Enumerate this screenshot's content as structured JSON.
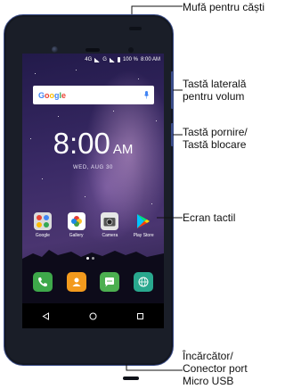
{
  "labels": {
    "headphone_jack": "Mufă pentru căști",
    "volume_key_1": "Tastă laterală",
    "volume_key_2": "pentru volum",
    "power_key_1": "Tastă pornire/",
    "power_key_2": "Tastă blocare",
    "touchscreen": "Ecran tactil",
    "charger_1": "Încărcător/",
    "charger_2": "Conector port",
    "charger_3": "Micro USB"
  },
  "screen": {
    "status": {
      "network": "4G",
      "network2": "G",
      "battery": "100 %",
      "time": "8:00 AM"
    },
    "search": {
      "logo": "Google",
      "icon": "mic-icon"
    },
    "clock": {
      "time": "8:00",
      "ampm": "AM",
      "date": "WED, AUG 30"
    },
    "apps": [
      {
        "label": "Google",
        "icon": "google-folder-icon",
        "color": "#d8d8d8"
      },
      {
        "label": "Gallery",
        "icon": "gallery-icon",
        "color": "#ffffff"
      },
      {
        "label": "Camera",
        "icon": "camera-icon",
        "color": "#e6e6e6"
      },
      {
        "label": "Play Store",
        "icon": "play-store-icon",
        "color": "transparent"
      }
    ],
    "dock": [
      {
        "icon": "phone-icon",
        "color": "#3ea84a"
      },
      {
        "icon": "contacts-icon",
        "color": "#f39a1d"
      },
      {
        "icon": "messages-icon",
        "color": "#4caf50"
      },
      {
        "icon": "browser-icon",
        "color": "#29a88e"
      }
    ],
    "nav": {
      "back": "◁",
      "home": "○",
      "recents": "□"
    }
  }
}
